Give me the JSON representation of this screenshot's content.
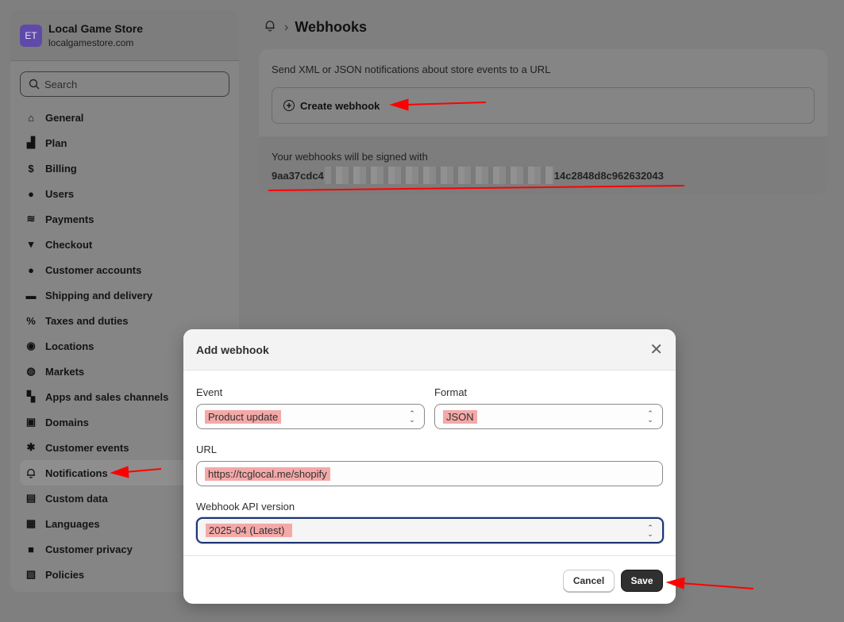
{
  "store": {
    "initials": "ET",
    "name": "Local Game Store",
    "domain": "localgamestore.com"
  },
  "search": {
    "placeholder": "Search"
  },
  "sidebar": {
    "items": [
      {
        "label": "General",
        "icon": "store-icon"
      },
      {
        "label": "Plan",
        "icon": "plan-icon"
      },
      {
        "label": "Billing",
        "icon": "billing-icon"
      },
      {
        "label": "Users",
        "icon": "users-icon"
      },
      {
        "label": "Payments",
        "icon": "payments-icon"
      },
      {
        "label": "Checkout",
        "icon": "cart-icon"
      },
      {
        "label": "Customer accounts",
        "icon": "person-icon"
      },
      {
        "label": "Shipping and delivery",
        "icon": "truck-icon"
      },
      {
        "label": "Taxes and duties",
        "icon": "tax-icon"
      },
      {
        "label": "Locations",
        "icon": "location-icon"
      },
      {
        "label": "Markets",
        "icon": "globe-icon"
      },
      {
        "label": "Apps and sales channels",
        "icon": "apps-icon"
      },
      {
        "label": "Domains",
        "icon": "domains-icon"
      },
      {
        "label": "Customer events",
        "icon": "cursor-icon"
      },
      {
        "label": "Notifications",
        "icon": "bell-icon",
        "active": true
      },
      {
        "label": "Custom data",
        "icon": "custom-data-icon"
      },
      {
        "label": "Languages",
        "icon": "languages-icon"
      },
      {
        "label": "Customer privacy",
        "icon": "lock-icon"
      },
      {
        "label": "Policies",
        "icon": "policies-icon"
      }
    ]
  },
  "header": {
    "title": "Webhooks"
  },
  "webhooks": {
    "description": "Send XML or JSON notifications about store events to a URL",
    "create_label": "Create webhook",
    "signed_label": "Your webhooks will be signed with",
    "key_start": "9aa37cdc4",
    "key_end": "14c2848d8c962632043"
  },
  "modal": {
    "title": "Add webhook",
    "event_label": "Event",
    "event_value": "Product update",
    "format_label": "Format",
    "format_value": "JSON",
    "url_label": "URL",
    "url_value": "https://tcglocal.me/shopify",
    "api_label": "Webhook API version",
    "api_value": "2025-04 (Latest)",
    "cancel_label": "Cancel",
    "save_label": "Save"
  },
  "colors": {
    "annotation": "#ff0000",
    "highlight": "#f4a9a9",
    "focus": "#1d3572"
  }
}
